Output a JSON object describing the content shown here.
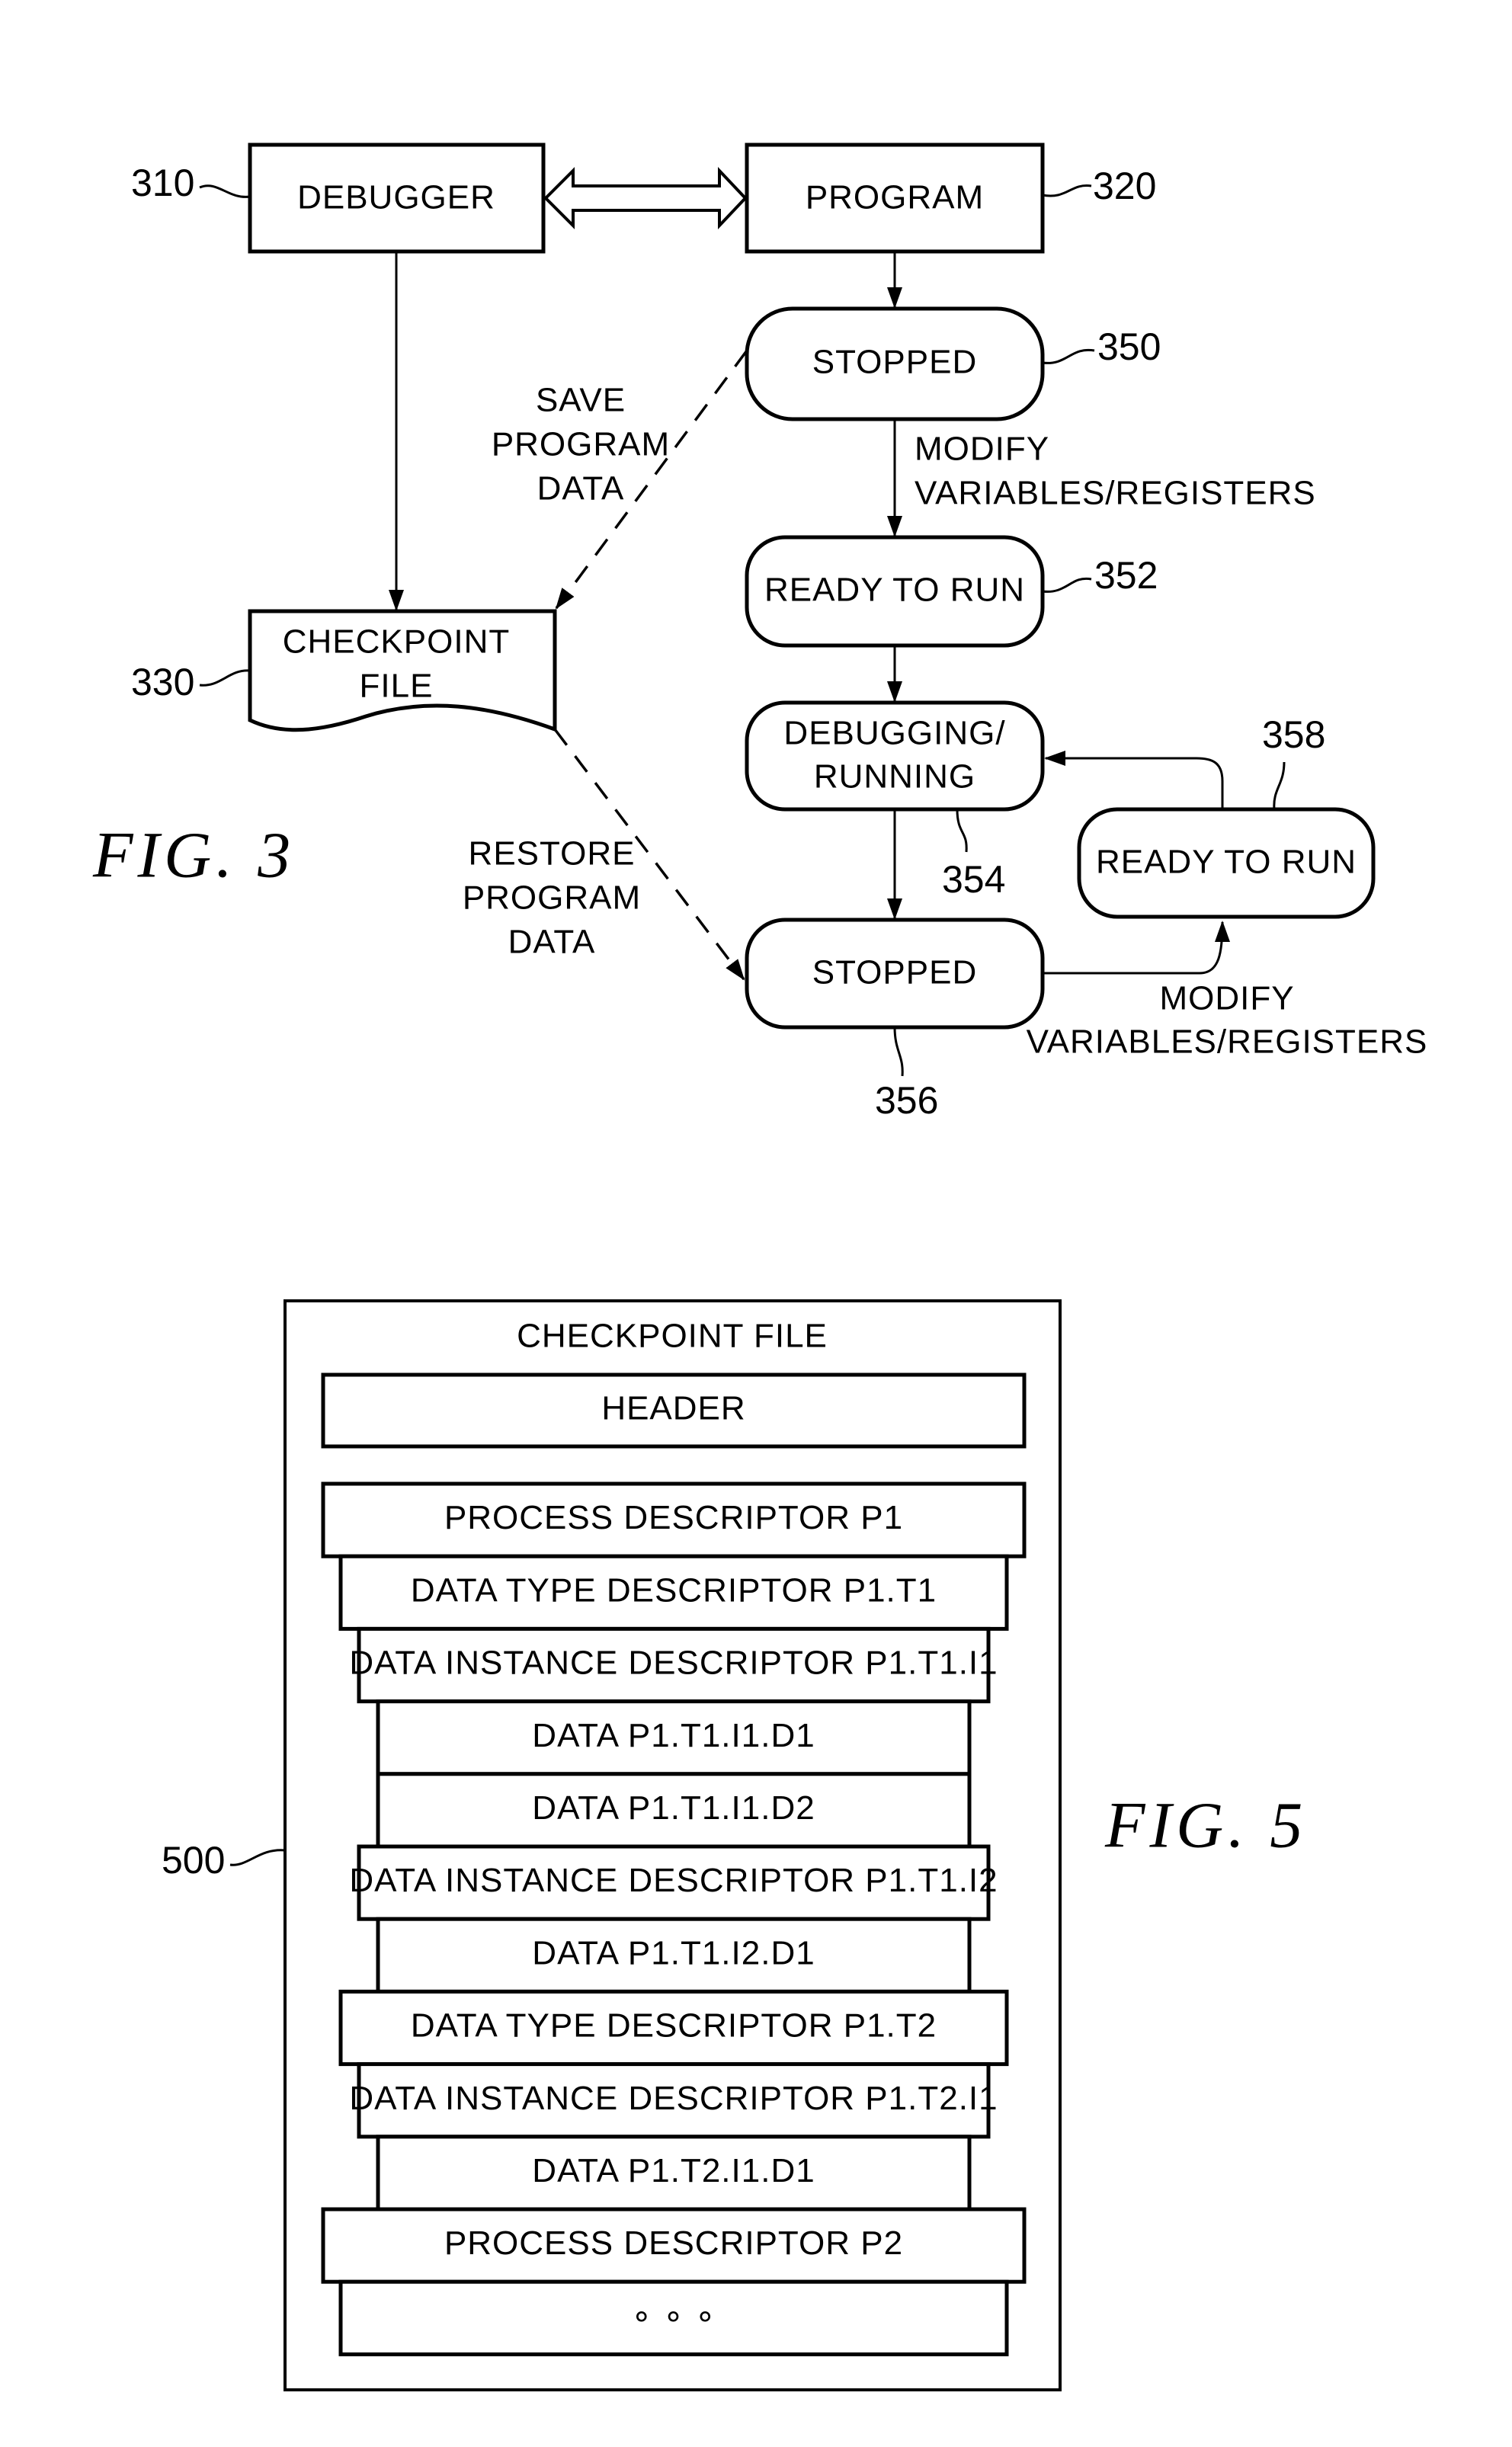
{
  "fig3": {
    "caption": "FIG. 3",
    "nodes": {
      "debugger": {
        "label": "DEBUGGER",
        "ref": "310"
      },
      "program": {
        "label": "PROGRAM",
        "ref": "320"
      },
      "checkpoint": {
        "line1": "CHECKPOINT",
        "line2": "FILE",
        "ref": "330"
      },
      "stopped1": {
        "label": "STOPPED",
        "ref": "350"
      },
      "ready1": {
        "label": "READY TO RUN",
        "ref": "352"
      },
      "debugging": {
        "line1": "DEBUGGING/",
        "line2": "RUNNING",
        "ref": "354"
      },
      "stopped2": {
        "label": "STOPPED",
        "ref": "356"
      },
      "ready2": {
        "label": "READY TO RUN",
        "ref": "358"
      }
    },
    "edge_labels": {
      "save": [
        "SAVE",
        "PROGRAM",
        "DATA"
      ],
      "restore": [
        "RESTORE",
        "PROGRAM",
        "DATA"
      ],
      "modify_top": [
        "MODIFY",
        "VARIABLES/REGISTERS"
      ],
      "modify_bottom": [
        "MODIFY",
        "VARIABLES/REGISTERS"
      ]
    }
  },
  "fig5": {
    "caption": "FIG. 5",
    "ref": "500",
    "title": "CHECKPOINT FILE",
    "header": "HEADER",
    "rows": [
      {
        "label": "PROCESS DESCRIPTOR P1",
        "level": 0
      },
      {
        "label": "DATA TYPE DESCRIPTOR P1.T1",
        "level": 1
      },
      {
        "label": "DATA INSTANCE DESCRIPTOR P1.T1.I1",
        "level": 2
      },
      {
        "label": "DATA P1.T1.I1.D1",
        "level": 3
      },
      {
        "label": "DATA P1.T1.I1.D2",
        "level": 3
      },
      {
        "label": "DATA INSTANCE DESCRIPTOR P1.T1.I2",
        "level": 2
      },
      {
        "label": "DATA P1.T1.I2.D1",
        "level": 3
      },
      {
        "label": "DATA TYPE DESCRIPTOR P1.T2",
        "level": 1
      },
      {
        "label": "DATA INSTANCE DESCRIPTOR P1.T2.I1",
        "level": 2
      },
      {
        "label": "DATA P1.T2.I1.D1",
        "level": 3
      },
      {
        "label": "PROCESS DESCRIPTOR P2",
        "level": 0
      },
      {
        "label": "∘ ∘ ∘",
        "level": 1
      }
    ]
  }
}
